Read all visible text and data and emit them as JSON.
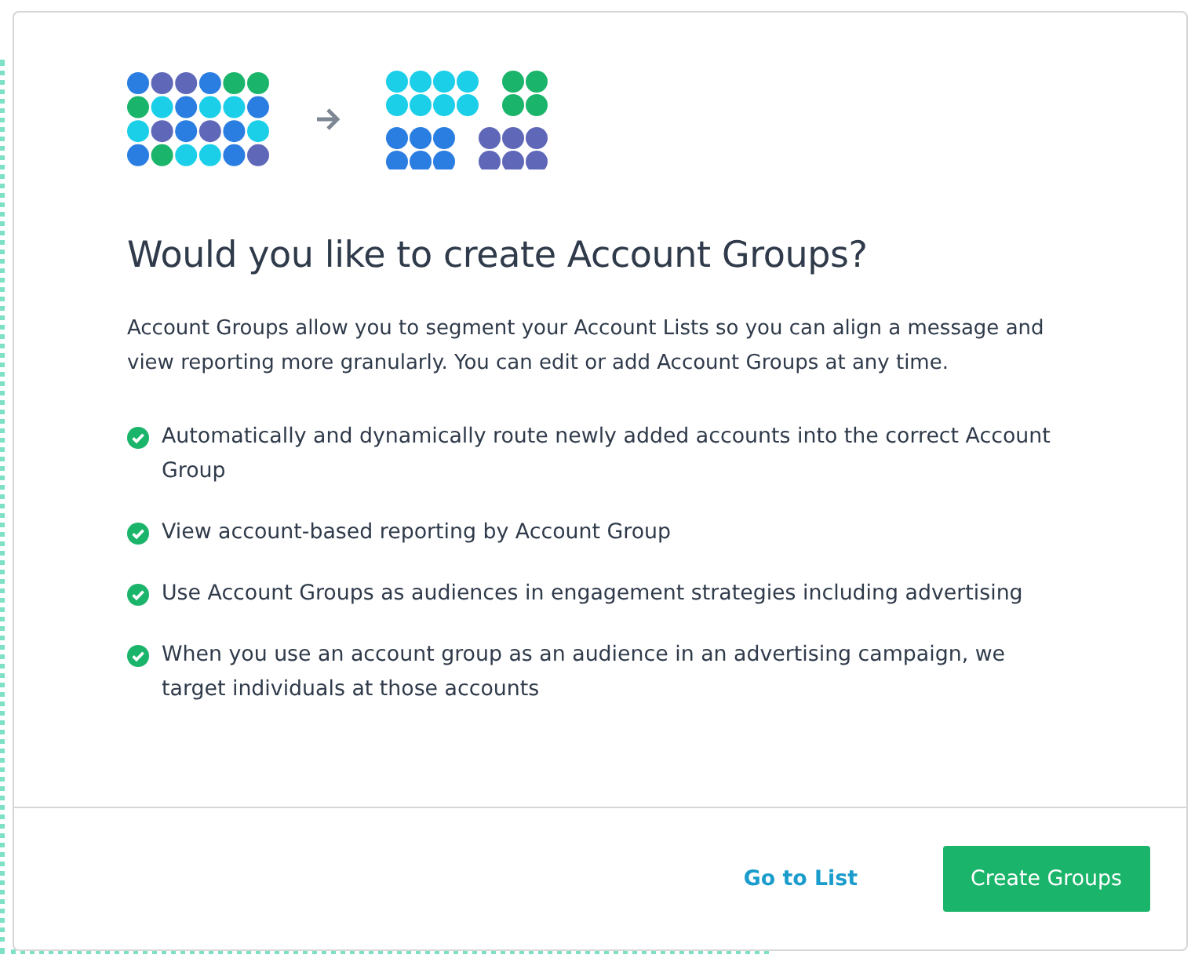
{
  "dialog": {
    "title": "Would you like to create Account Groups?",
    "description": "Account Groups allow you to segment your Account Lists so you can align a message and view reporting more granularly. You can edit or add Account Groups at any time.",
    "benefits": [
      {
        "text": "Automatically and dynamically route newly added accounts into the correct Account Group",
        "checked": true
      },
      {
        "text": "View account-based reporting by Account Group",
        "checked": true
      },
      {
        "text": "Use Account Groups as audiences in engagement strategies including advertising",
        "checked": true
      },
      {
        "text": "When you use an account group as an audience in an advertising campaign, we target individuals at those accounts",
        "checked": true
      }
    ],
    "buttons": [
      {
        "label": "Go to List",
        "kind": "link"
      },
      {
        "label": "Create Groups",
        "kind": "primary"
      }
    ]
  }
}
